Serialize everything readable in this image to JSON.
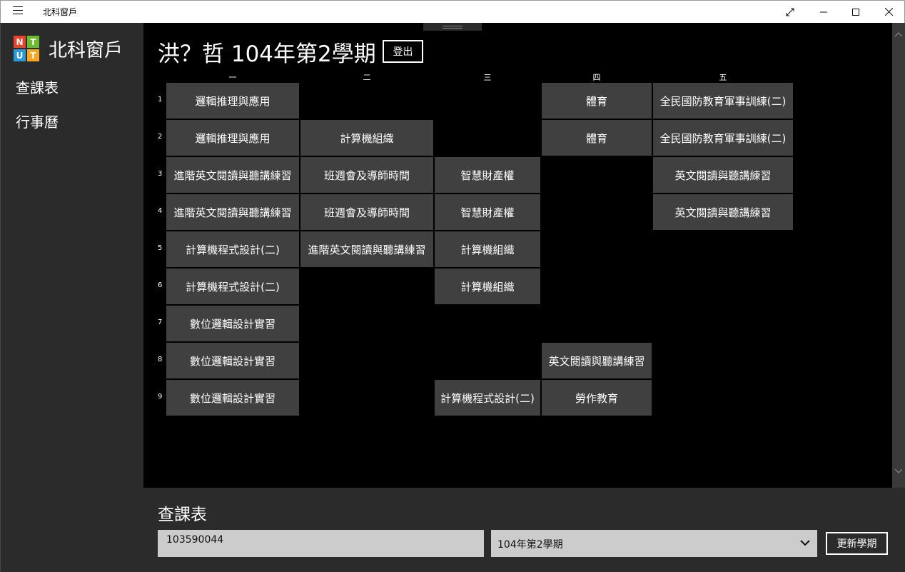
{
  "window": {
    "title": "北科窗戶"
  },
  "sidebar": {
    "logo": {
      "letters": [
        "N",
        "T",
        "U",
        "T"
      ],
      "colors": [
        "#e8432d",
        "#6cbb2d",
        "#2a9bd8",
        "#f5a623"
      ]
    },
    "brand": "北科窗戶",
    "items": [
      {
        "label": "查課表"
      },
      {
        "label": "行事曆"
      }
    ]
  },
  "header": {
    "title": "洪？哲 104年第2學期",
    "logout_label": "登出"
  },
  "timetable": {
    "days": [
      "一",
      "二",
      "三",
      "四",
      "五"
    ],
    "periods": [
      "1",
      "2",
      "3",
      "4",
      "5",
      "6",
      "7",
      "8",
      "9"
    ],
    "courses": {
      "mon": [
        "邏輯推理與應用",
        "邏輯推理與應用",
        "進階英文閱讀與聽講練習",
        "進階英文閱讀與聽講練習",
        "計算機程式設計(二)",
        "計算機程式設計(二)",
        "數位邏輯設計實習",
        "數位邏輯設計實習",
        "數位邏輯設計實習"
      ],
      "tue": [
        "",
        "計算機組織",
        "班週會及導師時間",
        "班週會及導師時間",
        "進階英文閱讀與聽講練習",
        "",
        "",
        "",
        ""
      ],
      "wed": [
        "",
        "",
        "智慧財產權",
        "智慧財產權",
        "計算機組織",
        "計算機組織",
        "",
        "",
        "計算機程式設計(二)"
      ],
      "thu": [
        "體育",
        "體育",
        "",
        "",
        "",
        "",
        "",
        "英文閱讀與聽講練習",
        "勞作教育"
      ],
      "fri": [
        "全民國防教育軍事訓練(二)",
        "全民國防教育軍事訓練(二)",
        "英文閱讀與聽講練習",
        "英文閱讀與聽講練習",
        "",
        "",
        "",
        "",
        ""
      ]
    }
  },
  "query": {
    "title": "查課表",
    "student_id": "103590044",
    "semester_selected": "104年第2學期",
    "update_label": "更新學期"
  }
}
